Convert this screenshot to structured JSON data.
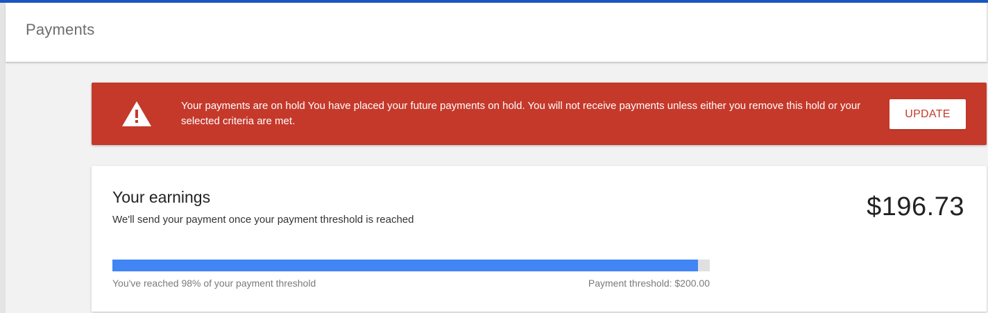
{
  "header": {
    "title": "Payments"
  },
  "alert": {
    "icon": "warning-icon",
    "message": "Your payments are on hold You have placed your future payments on hold. You will not receive payments unless either you remove this hold or your selected criteria are met.",
    "button_label": "UPDATE"
  },
  "earnings": {
    "title": "Your earnings",
    "subtitle": "We'll send your payment once your payment threshold is reached",
    "amount": "$196.73",
    "progress_fraction": 0.98,
    "progress_caption": "You've reached 98% of your payment threshold",
    "threshold_caption": "Payment threshold: $200.00"
  },
  "colors": {
    "accent_top": "#1a55c2",
    "alert_bg": "#c5392b",
    "progress_fill": "#4285f4",
    "progress_track": "#e0e0e0"
  }
}
